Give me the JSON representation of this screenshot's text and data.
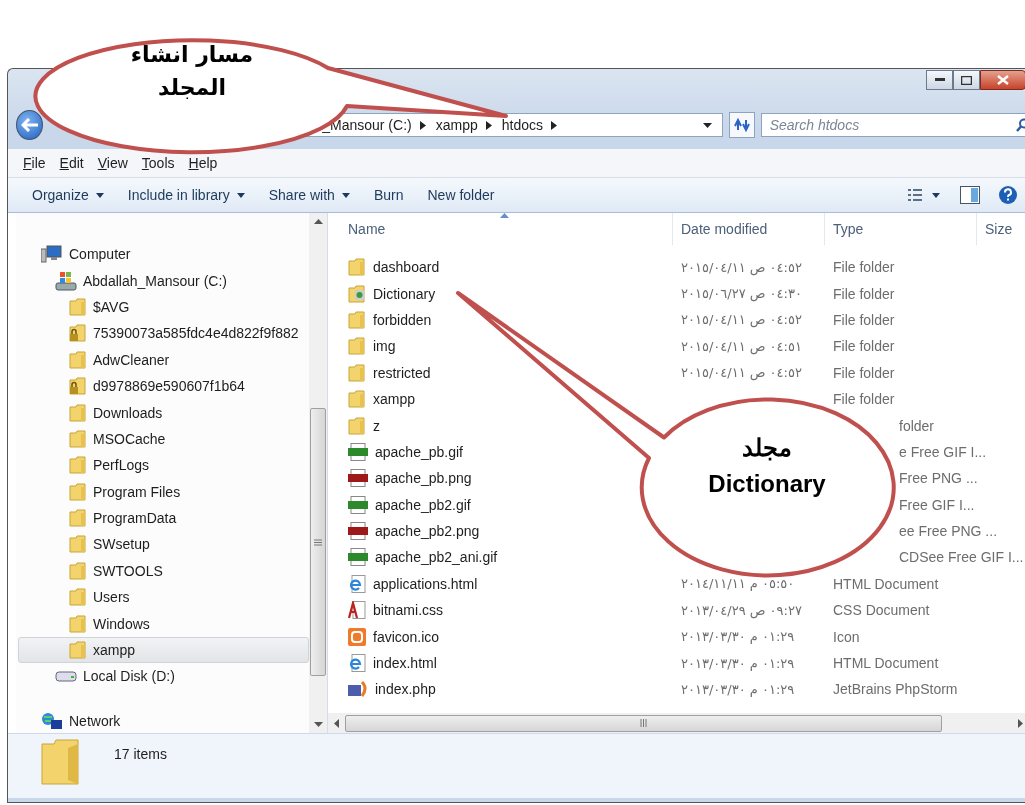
{
  "annotations": [
    {
      "lines": [
        "مسار انشاء",
        "المجلد"
      ]
    },
    {
      "lines": [
        "مجلد",
        "Dictionary"
      ]
    }
  ],
  "address_bar": {
    "breadcrumbs": [
      "_Mansour (C:)",
      "xampp",
      "htdocs"
    ]
  },
  "search": {
    "placeholder": "Search htdocs"
  },
  "menu": [
    "File",
    "Edit",
    "View",
    "Tools",
    "Help"
  ],
  "toolbar": [
    {
      "label": "Organize",
      "dropdown": true
    },
    {
      "label": "Include in library",
      "dropdown": true
    },
    {
      "label": "Share with",
      "dropdown": true
    },
    {
      "label": "Burn",
      "dropdown": false
    },
    {
      "label": "New folder",
      "dropdown": false
    }
  ],
  "navigation": [
    {
      "label": "Computer",
      "kind": "computer",
      "selected": false,
      "children": [
        {
          "label": "Abdallah_Mansour (C:)",
          "kind": "system-drive",
          "selected": false,
          "children": [
            {
              "label": "$AVG",
              "kind": "folder",
              "selected": false
            },
            {
              "label": "75390073a585fdc4e4d822f9f882",
              "kind": "locked-folder",
              "selected": false
            },
            {
              "label": "AdwCleaner",
              "kind": "folder",
              "selected": false
            },
            {
              "label": "d9978869e590607f1b64",
              "kind": "locked-folder",
              "selected": false
            },
            {
              "label": "Downloads",
              "kind": "folder",
              "selected": false
            },
            {
              "label": "MSOCache",
              "kind": "folder",
              "selected": false
            },
            {
              "label": "PerfLogs",
              "kind": "folder",
              "selected": false
            },
            {
              "label": "Program Files",
              "kind": "folder",
              "selected": false
            },
            {
              "label": "ProgramData",
              "kind": "folder",
              "selected": false
            },
            {
              "label": "SWsetup",
              "kind": "folder",
              "selected": false
            },
            {
              "label": "SWTOOLS",
              "kind": "folder",
              "selected": false
            },
            {
              "label": "Users",
              "kind": "folder",
              "selected": false
            },
            {
              "label": "Windows",
              "kind": "folder",
              "selected": false
            },
            {
              "label": "xampp",
              "kind": "folder",
              "selected": true
            }
          ]
        },
        {
          "label": "Local Disk (D:)",
          "kind": "disk",
          "selected": false
        }
      ]
    },
    {
      "label": "Network",
      "kind": "network",
      "selected": false
    }
  ],
  "columns": [
    {
      "label": "Name",
      "sorted": true
    },
    {
      "label": "Date modified",
      "sorted": false
    },
    {
      "label": "Type",
      "sorted": false
    },
    {
      "label": "Size",
      "sorted": false
    }
  ],
  "files": [
    {
      "name": "dashboard",
      "kind": "folder",
      "date": "٠٤:٥٢ ص ٢٠١٥/٠٤/١١",
      "type": "File folder",
      "partly_covered": false
    },
    {
      "name": "Dictionary",
      "kind": "web-folder",
      "date": "٠٤:٣٠ ص ٢٠١٥/٠٦/٢٧",
      "type": "File folder",
      "partly_covered": false
    },
    {
      "name": "forbidden",
      "kind": "folder",
      "date": "٠٤:٥٢ ص ٢٠١٥/٠٤/١١",
      "type": "File folder",
      "partly_covered": false
    },
    {
      "name": "img",
      "kind": "folder",
      "date": "٠٤:٥١ ص ٢٠١٥/٠٤/١١",
      "type": "File folder",
      "partly_covered": false
    },
    {
      "name": "restricted",
      "kind": "folder",
      "date": "٠٤:٥٢ ص ٢٠١٥/٠٤/١١",
      "type": "File folder",
      "partly_covered": false
    },
    {
      "name": "xampp",
      "kind": "folder",
      "type": "File folder",
      "partly_covered": false
    },
    {
      "name": "z",
      "kind": "folder",
      "type": "folder",
      "partly_covered": true
    },
    {
      "name": "apache_pb.gif",
      "kind": "gif",
      "type": "e Free GIF I...",
      "partly_covered": true
    },
    {
      "name": "apache_pb.png",
      "kind": "png",
      "type": "Free PNG ...",
      "partly_covered": true
    },
    {
      "name": "apache_pb2.gif",
      "kind": "gif",
      "type": "Free GIF I...",
      "partly_covered": true
    },
    {
      "name": "apache_pb2.png",
      "kind": "png",
      "type": "ee Free PNG ...",
      "partly_covered": true
    },
    {
      "name": "apache_pb2_ani.gif",
      "kind": "gif",
      "type": "CDSee Free GIF I...",
      "partly_covered": true
    },
    {
      "name": "applications.html",
      "kind": "html",
      "date": "٠٥:٥٠ م ٢٠١٤/١١/١١",
      "type": "HTML Document",
      "partly_covered": false
    },
    {
      "name": "bitnami.css",
      "kind": "css",
      "date": "٠٩:٢٧ ص ٢٠١٣/٠٤/٢٩",
      "type": "CSS Document",
      "partly_covered": false
    },
    {
      "name": "favicon.ico",
      "kind": "ico",
      "date": "٠١:٢٩ م ٢٠١٣/٠٣/٣٠",
      "type": "Icon",
      "partly_covered": false
    },
    {
      "name": "index.html",
      "kind": "html",
      "date": "٠١:٢٩ م ٢٠١٣/٠٣/٣٠",
      "type": "HTML Document",
      "partly_covered": false
    },
    {
      "name": "index.php",
      "kind": "php",
      "date": "٠١:٢٩ م ٢٠١٣/٠٣/٣٠",
      "type": "JetBrains PhpStorm",
      "partly_covered": false
    }
  ],
  "status_bar": {
    "count": "17 items"
  }
}
